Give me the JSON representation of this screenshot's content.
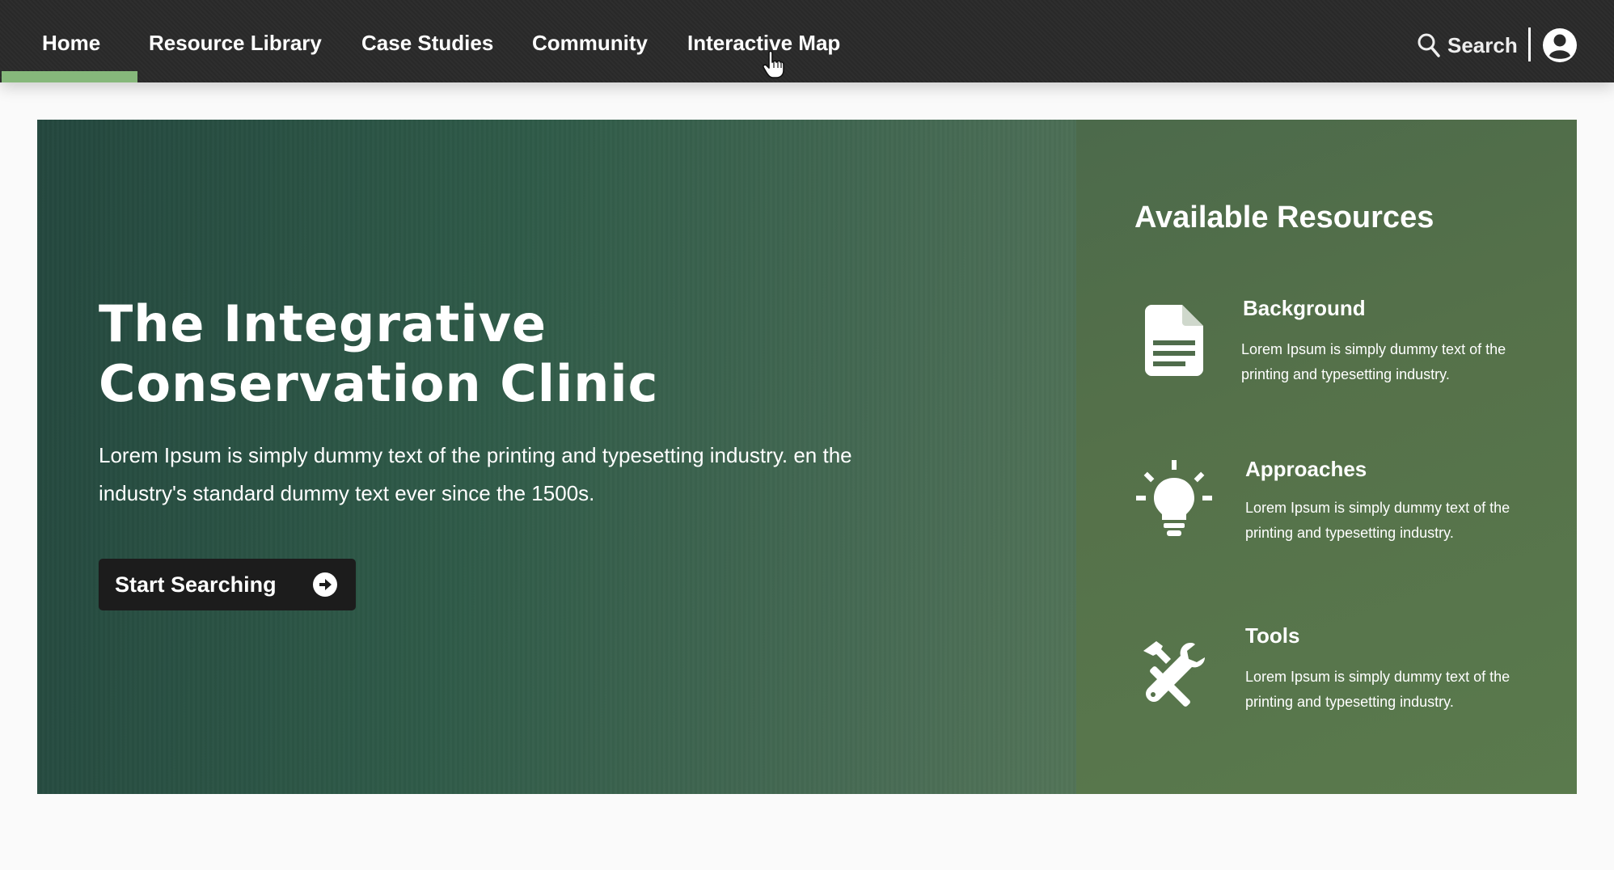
{
  "nav": {
    "items": [
      {
        "label": "Home"
      },
      {
        "label": "Resource Library"
      },
      {
        "label": "Case Studies"
      },
      {
        "label": "Community"
      },
      {
        "label": "Interactive Map"
      }
    ],
    "active_index": 0,
    "search_label": "Search",
    "icons": {
      "search": "search-icon",
      "account": "user-circle-icon",
      "cursor": "hand-pointer-icon"
    }
  },
  "hero": {
    "title_line1": "The Integrative",
    "title_line2": "Conservation Clinic",
    "description": "Lorem Ipsum is simply dummy text of the printing and typesetting industry. en the industry's standard dummy text ever since the 1500s.",
    "cta_label": "Start Searching",
    "cta_icon": "arrow-circle-right-icon"
  },
  "resources": {
    "heading": "Available Resources",
    "items": [
      {
        "title": "Background",
        "description": "Lorem Ipsum is simply dummy text of the printing and typesetting industry.",
        "icon": "document-icon"
      },
      {
        "title": "Approaches",
        "description": "Lorem Ipsum is simply dummy text of the printing and typesetting industry.",
        "icon": "lightbulb-icon"
      },
      {
        "title": "Tools",
        "description": "Lorem Ipsum is simply dummy text of the printing and typesetting industry.",
        "icon": "tools-icon"
      }
    ]
  },
  "colors": {
    "nav_bg": "#2a2a2a",
    "nav_active": "#86b87b",
    "cta_bg": "#1c1c1c",
    "hero_dark": "#24473e",
    "hero_light": "#6d8b5f"
  }
}
